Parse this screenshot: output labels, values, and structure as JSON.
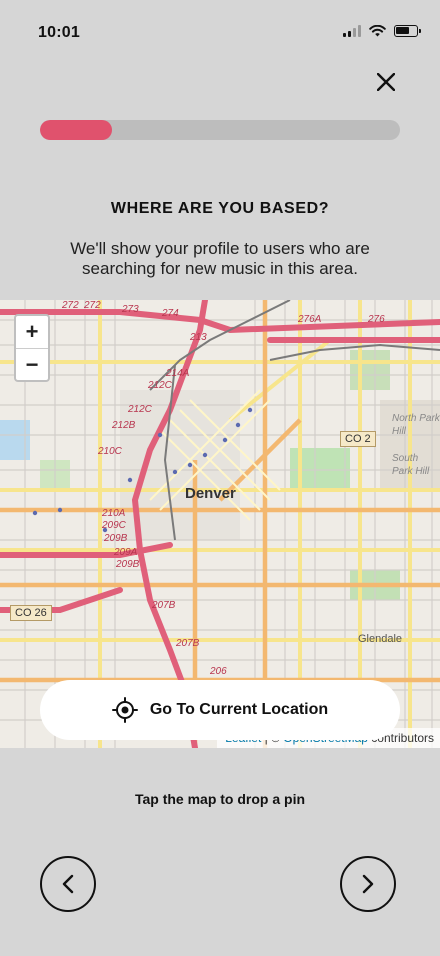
{
  "status_bar": {
    "time": "10:01"
  },
  "progress": {
    "value": 0.2
  },
  "onboarding": {
    "heading": "WHERE ARE YOU BASED?",
    "subtitle": "We'll show your profile to users who are searching for new music in this area.",
    "locate_button_label": "Go To Current Location",
    "hint": "Tap the map to drop a pin"
  },
  "map": {
    "city_label": "Denver",
    "zoom_in_label": "+",
    "zoom_out_label": "−",
    "attribution": {
      "leaflet": "Leaflet",
      "separator": " | © ",
      "osm": "OpenStreetMap",
      "suffix": " contributors"
    },
    "labels": {
      "co2": "CO 2",
      "co26": "CO 26",
      "north_park_hill": "North Park Hill",
      "south_park_hill": "South Park Hill",
      "glendale": "Glendale",
      "exits": [
        "272",
        "272",
        "273",
        "274",
        "213",
        "214A",
        "212C",
        "212C",
        "212B",
        "210C",
        "210A",
        "209C",
        "209B",
        "209A",
        "209B",
        "207B",
        "207B",
        "206",
        "276A",
        "276"
      ]
    }
  },
  "colors": {
    "accent": "#e0526d",
    "background": "#d6d6d6"
  },
  "icons": [
    "close-icon",
    "crosshair-icon",
    "chevron-left-icon",
    "chevron-right-icon",
    "wifi-icon",
    "battery-icon",
    "signal-icon"
  ]
}
